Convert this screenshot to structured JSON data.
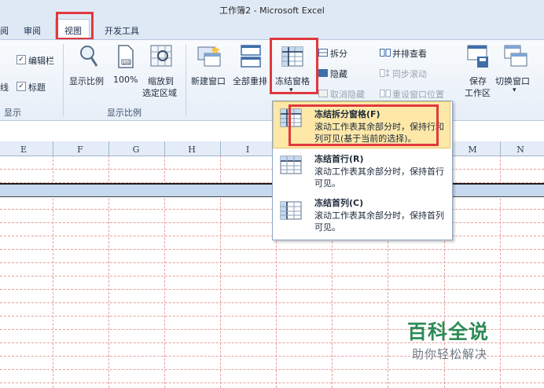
{
  "window": {
    "title": "工作簿2 - Microsoft Excel"
  },
  "tabs": [
    {
      "label": "阅"
    },
    {
      "label": "审阅"
    },
    {
      "label": "视图"
    },
    {
      "label": "开发工具"
    }
  ],
  "ribbon": {
    "show_group": {
      "label": "显示",
      "checkboxes": [
        {
          "label": "编辑栏",
          "checked": true
        },
        {
          "label": "标题",
          "checked": true
        }
      ],
      "partial_label": "线"
    },
    "zoom_group": {
      "label": "显示比例",
      "zoom_label": "显示比例",
      "hundred_label": "100%",
      "zoom_selection_line1": "缩放到",
      "zoom_selection_line2": "选定区域"
    },
    "window_group": {
      "new_window": "新建窗口",
      "arrange_all": "全部重排",
      "freeze_panes": "冻结窗格",
      "split": "拆分",
      "hide": "隐藏",
      "unhide": "取消隐藏",
      "side_by_side": "并排查看",
      "sync_scroll": "同步滚动",
      "reset_position": "重设窗口位置",
      "save_workspace_line1": "保存",
      "save_workspace_line2": "工作区",
      "switch_windows": "切换窗口"
    }
  },
  "menu": {
    "items": [
      {
        "title": "冻结拆分窗格(F)",
        "desc": "滚动工作表其余部分时，保持行和列可见(基于当前的选择)。"
      },
      {
        "title": "冻结首行(R)",
        "desc": "滚动工作表其余部分时，保持首行可见。"
      },
      {
        "title": "冻结首列(C)",
        "desc": "滚动工作表其余部分时，保持首列可见。"
      }
    ]
  },
  "columns": [
    "E",
    "F",
    "G",
    "H",
    "I",
    "M",
    "N"
  ],
  "watermark": {
    "title": "百科全说",
    "subtitle": "助你轻松解决"
  },
  "colors": {
    "highlight": "#e0393e",
    "menu_hover": "#fde8a8",
    "freeze_row": "#c6d9ee",
    "watermark": "#2e8b57"
  }
}
